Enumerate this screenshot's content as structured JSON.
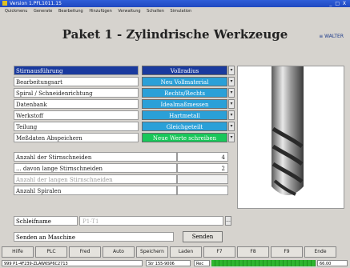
{
  "window": {
    "title": "Version 1.PFL1011.15",
    "controls": "_ □ X"
  },
  "menu": [
    "Quickmenu",
    "Generate",
    "Bearbeitung",
    "Hinzufügen",
    "Verwaltung",
    "Schalten",
    "Simulation"
  ],
  "header": {
    "title": "Paket 1 - Zylindrische Werkzeuge",
    "logo": "≡ WALTER"
  },
  "params": [
    {
      "label": "Stirnausführung",
      "value": "Vollradius",
      "style": "sel",
      "label_selected": true
    },
    {
      "label": "Bearbeitungsart",
      "value": "Neu Vollmaterial",
      "style": "blue"
    },
    {
      "label": "Spiral / Schneidenrichtung",
      "value": "Rechts/Rechts",
      "style": "blue"
    },
    {
      "label": "Datenbank",
      "value": "Idealmaßmessen",
      "style": "blue"
    },
    {
      "label": "Werkstoff",
      "value": "Hartmetall",
      "style": "blue"
    },
    {
      "label": "Teilung",
      "value": "Gleichgeteilt",
      "style": "blue"
    },
    {
      "label": "Meßdaten Abspeichern",
      "value": "Neue Werte schreiben",
      "style": "green"
    }
  ],
  "numeric": [
    {
      "label": "Anzahl der Stirnschneiden",
      "value": "4",
      "grey": false
    },
    {
      "label": "... davon lange Stirnschneiden",
      "value": "2",
      "grey": false
    },
    {
      "label": "Anzahl der langen Stirnschneiden",
      "value": "",
      "grey": true
    },
    {
      "label": "Anzahl Spiralen",
      "value": "",
      "grey": false
    }
  ],
  "grinding": {
    "label": "Schleifname",
    "value": "P1-T1",
    "browse": "..."
  },
  "send": {
    "label": "Senden an Maschine",
    "button": "Senden"
  },
  "fkeys": [
    "Hilfe",
    "PLC",
    "Fred",
    "Auto",
    "Speichern",
    "Laden",
    "F7",
    "F8",
    "F9",
    "Ende"
  ],
  "status": {
    "field1": "999  P1-4F239-ZLAW6SP6C2713",
    "field2": "Str 155-9006",
    "field3": "Rec",
    "field4": "66.00"
  },
  "colors": {
    "value_blue": "#2aa0d8",
    "value_green": "#19c75a",
    "selected": "#1a3a9e"
  }
}
